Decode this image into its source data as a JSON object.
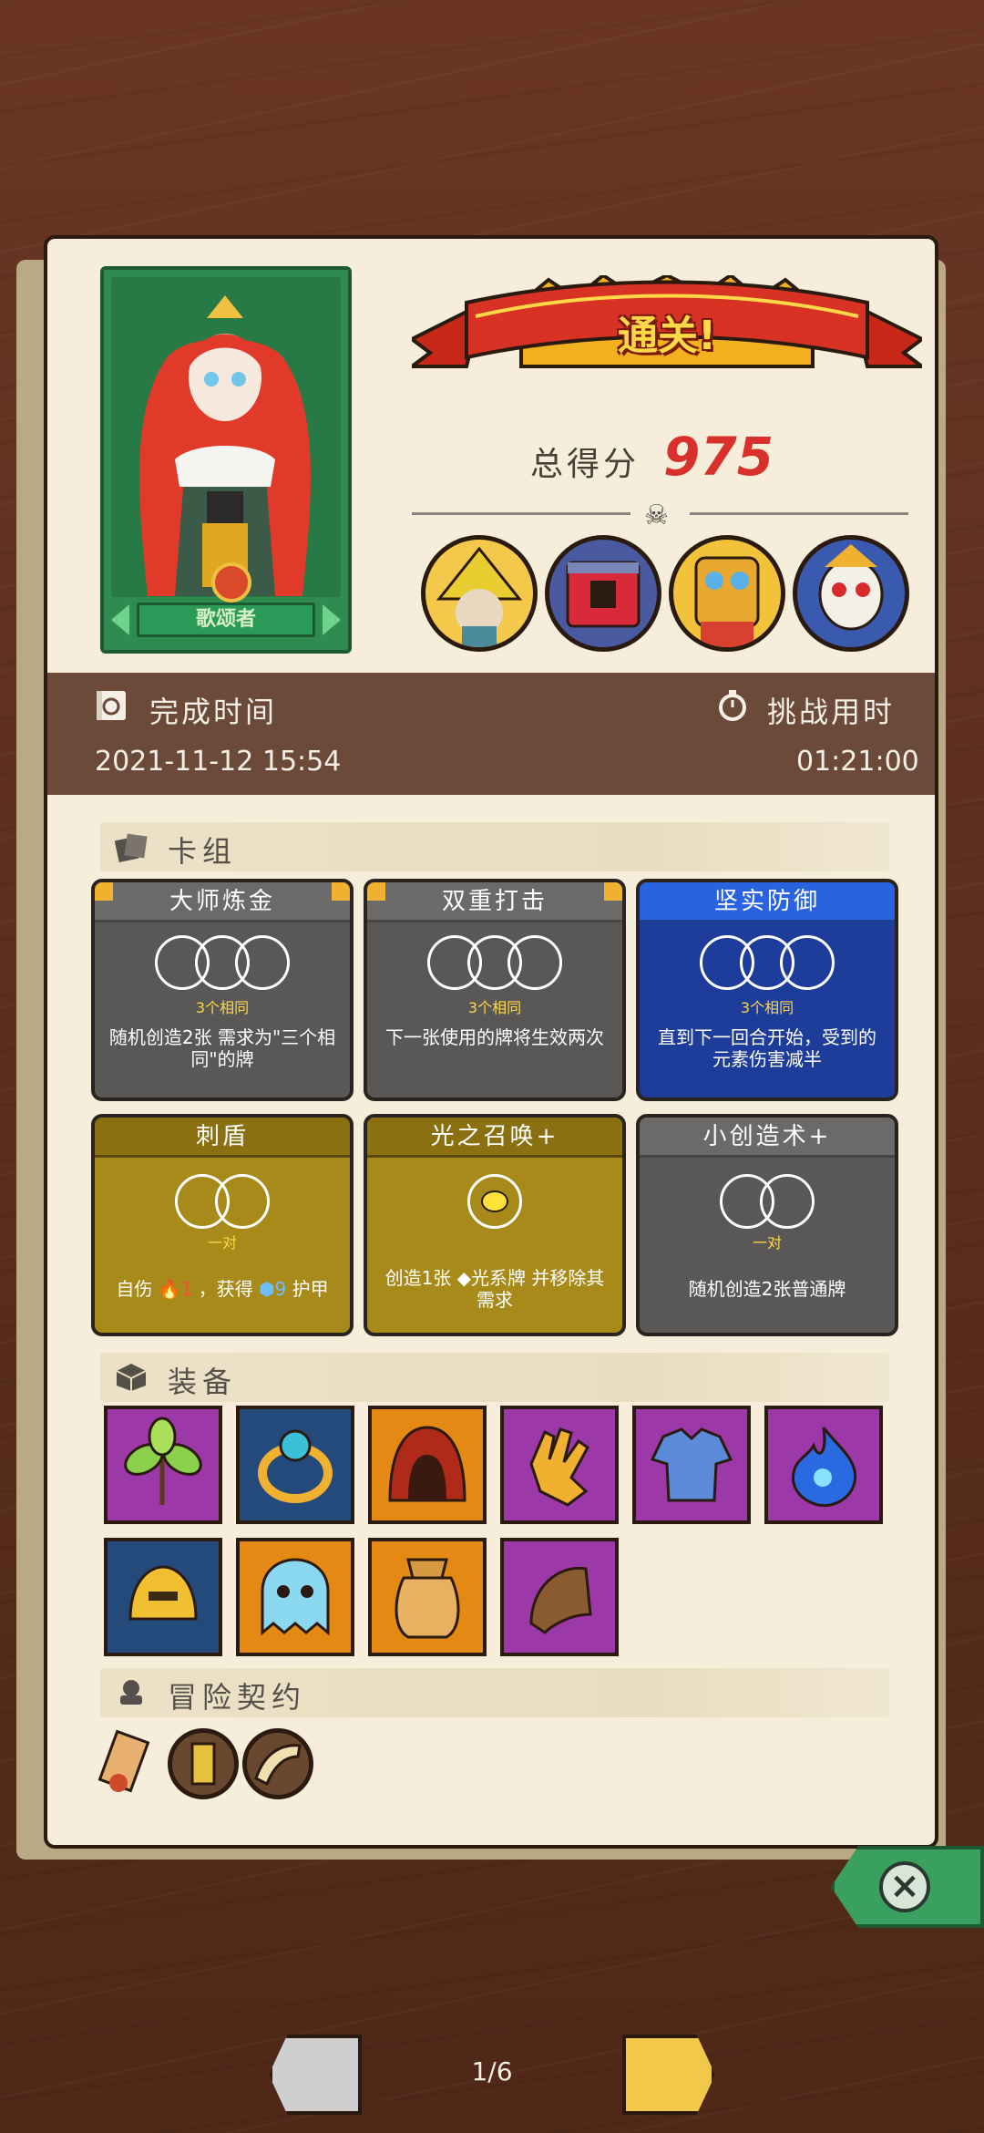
{
  "character": {
    "name": "歌颂者"
  },
  "result": {
    "banner": "通关!",
    "score_label": "总得分",
    "score_value": "975"
  },
  "bosses": [
    "boss-wizard",
    "boss-chest",
    "boss-masked",
    "boss-skull"
  ],
  "time": {
    "finish_label": "完成时间",
    "finish_value": "2021-11-12  15:54",
    "challenge_label": "挑战用时",
    "challenge_value": "01:21:00"
  },
  "sections": {
    "deck": "卡组",
    "equipment": "装备",
    "contracts": "冒险契约"
  },
  "cards": [
    {
      "title": "大师炼金",
      "color": "gray",
      "rings": 3,
      "tag": "3个相同",
      "desc": "随机创造2张 需求为\"三个相同\"的牌"
    },
    {
      "title": "双重打击",
      "color": "gray",
      "rings": 3,
      "tag": "3个相同",
      "desc": "下一张使用的牌将生效两次"
    },
    {
      "title": "坚实防御",
      "color": "blue",
      "rings": 3,
      "tag": "3个相同",
      "desc": "直到下一回合开始，受到的元素伤害减半"
    },
    {
      "title": "刺盾",
      "color": "gold",
      "rings": 2,
      "tag": "一对",
      "desc_a": "自伤",
      "desc_dmg": "🔥1",
      "desc_b": "，获得",
      "desc_armor": "9",
      "desc_c": "护甲"
    },
    {
      "title": "光之召唤+",
      "color": "gold",
      "rings": 1,
      "tag": "",
      "desc": "创造1张 ◆光系牌 并移除其需求"
    },
    {
      "title": "小创造术+",
      "color": "gray",
      "rings": 2,
      "tag": "一对",
      "desc": "随机创造2张普通牌"
    }
  ],
  "equipment": [
    {
      "icon": "herb-icon",
      "color": "#9c38a8"
    },
    {
      "icon": "ring-icon",
      "color": "#234a7a"
    },
    {
      "icon": "hood-icon",
      "color": "#e48a14"
    },
    {
      "icon": "glove-icon",
      "color": "#9c38a8"
    },
    {
      "icon": "tunic-icon",
      "color": "#9c38a8"
    },
    {
      "icon": "blue-flame-icon",
      "color": "#9c38a8"
    },
    {
      "icon": "helmet-icon",
      "color": "#234a7a"
    },
    {
      "icon": "ghost-icon",
      "color": "#e48a14"
    },
    {
      "icon": "sack-icon",
      "color": "#e48a14"
    },
    {
      "icon": "bracer-icon",
      "color": "#9c38a8"
    }
  ],
  "contracts": [
    "scroll-icon",
    "tag-icon",
    "horn-icon"
  ],
  "pager": {
    "current": "1/6"
  }
}
